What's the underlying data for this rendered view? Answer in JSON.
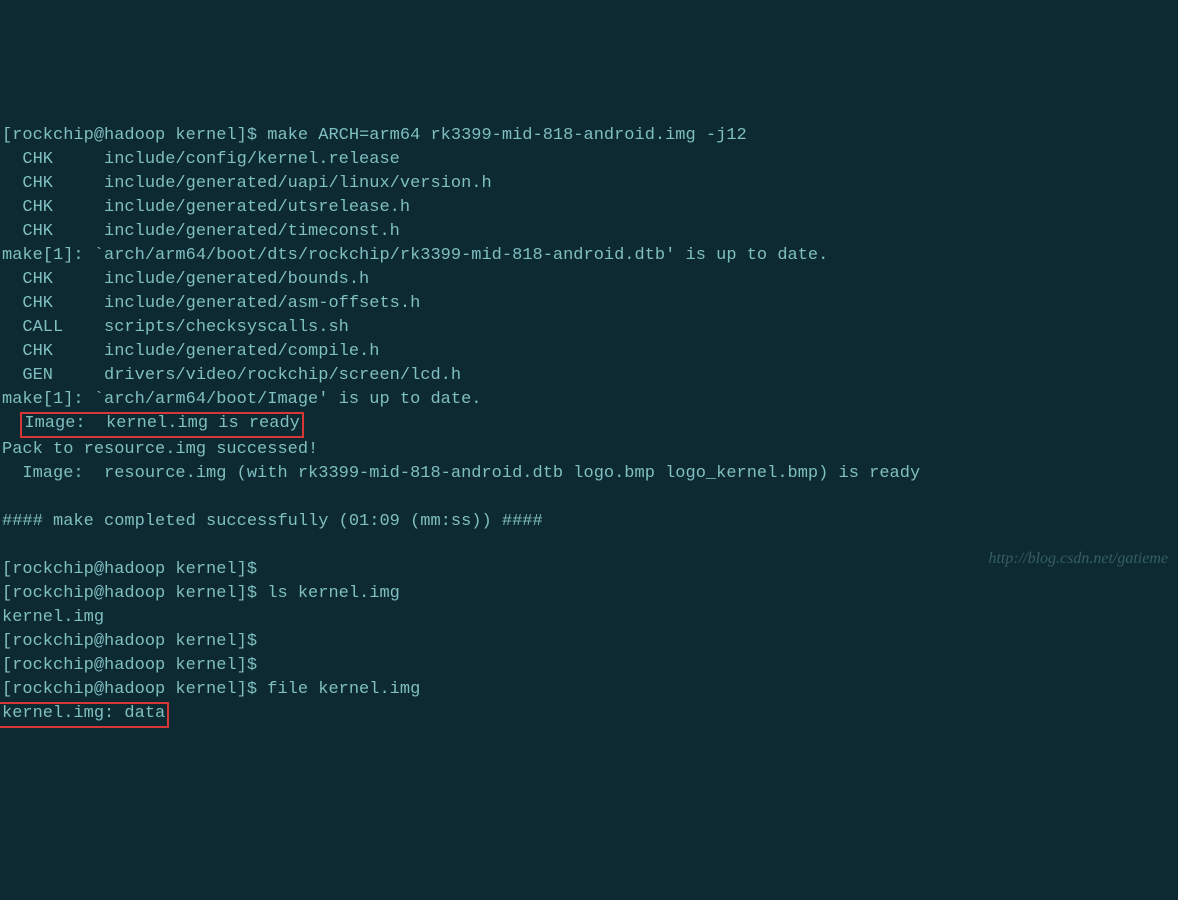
{
  "lines": {
    "l1": "[rockchip@hadoop kernel]$ make ARCH=arm64 rk3399-mid-818-android.img -j12",
    "l2": "  CHK     include/config/kernel.release",
    "l3": "  CHK     include/generated/uapi/linux/version.h",
    "l4": "  CHK     include/generated/utsrelease.h",
    "l5": "  CHK     include/generated/timeconst.h",
    "l6": "make[1]: `arch/arm64/boot/dts/rockchip/rk3399-mid-818-android.dtb' is up to date.",
    "l7": "  CHK     include/generated/bounds.h",
    "l8": "  CHK     include/generated/asm-offsets.h",
    "l9": "  CALL    scripts/checksyscalls.sh",
    "l10": "  CHK     include/generated/compile.h",
    "l11": "  GEN     drivers/video/rockchip/screen/lcd.h",
    "l12": "make[1]: `arch/arm64/boot/Image' is up to date.",
    "l13_pre": "  ",
    "l13_box": "Image:  kernel.img is ready",
    "l14": "Pack to resource.img successed!",
    "l15": "  Image:  resource.img (with rk3399-mid-818-android.dtb logo.bmp logo_kernel.bmp) is ready",
    "l16": "",
    "l17": "#### make completed successfully (01:09 (mm:ss)) ####",
    "l18": "",
    "l19": "[rockchip@hadoop kernel]$",
    "l20": "[rockchip@hadoop kernel]$ ls kernel.img",
    "l21": "kernel.img",
    "l22": "[rockchip@hadoop kernel]$",
    "l23": "[rockchip@hadoop kernel]$",
    "l24": "[rockchip@hadoop kernel]$ file kernel.img",
    "l25_box": "kernel.img: data"
  },
  "watermark": "http://blog.csdn.net/gatieme"
}
